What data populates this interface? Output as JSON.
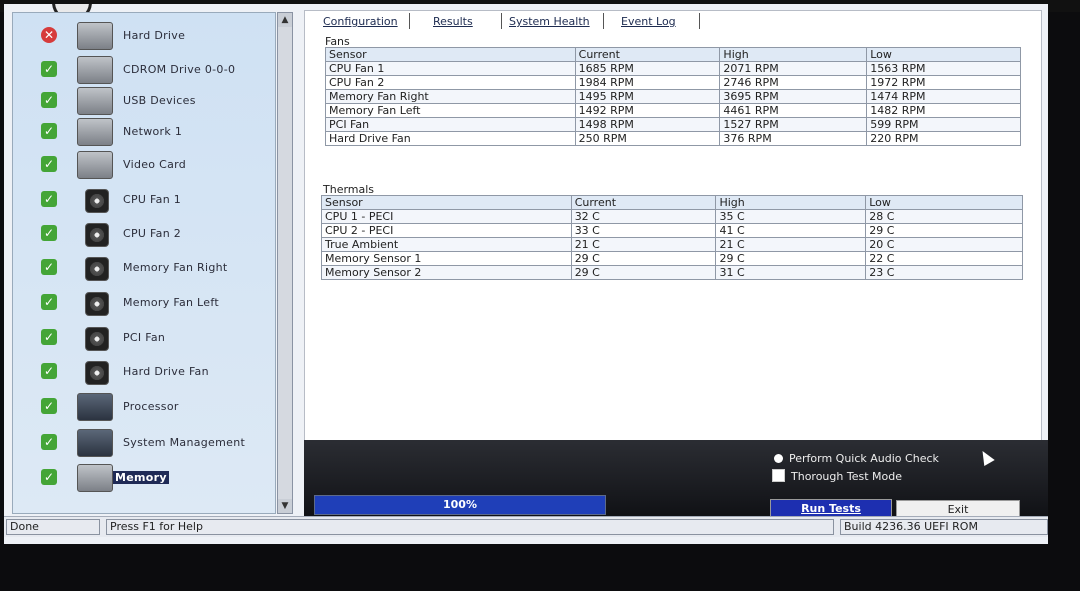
{
  "sidebar": {
    "items": [
      {
        "label": "Hard Drive",
        "status": "fail",
        "icon": "hard-drive-icon"
      },
      {
        "label": "CDROM Drive 0-0-0",
        "status": "pass",
        "icon": "cdrom-drive-icon"
      },
      {
        "label": "USB Devices",
        "status": "pass",
        "icon": "usb-icon"
      },
      {
        "label": "Network 1",
        "status": "pass",
        "icon": "network-card-icon"
      },
      {
        "label": "Video Card",
        "status": "pass",
        "icon": "video-card-icon"
      },
      {
        "label": "CPU Fan 1",
        "status": "pass",
        "icon": "fan-icon"
      },
      {
        "label": "CPU Fan 2",
        "status": "pass",
        "icon": "fan-icon"
      },
      {
        "label": "Memory Fan Right",
        "status": "pass",
        "icon": "fan-icon"
      },
      {
        "label": "Memory Fan Left",
        "status": "pass",
        "icon": "fan-icon"
      },
      {
        "label": "PCI Fan",
        "status": "pass",
        "icon": "fan-icon"
      },
      {
        "label": "Hard Drive Fan",
        "status": "pass",
        "icon": "fan-icon"
      },
      {
        "label": "Processor",
        "status": "pass",
        "icon": "processor-icon"
      },
      {
        "label": "System Management",
        "status": "pass",
        "icon": "system-management-icon"
      },
      {
        "label": "Memory",
        "status": "pass",
        "icon": "memory-icon",
        "selected": true
      }
    ]
  },
  "tabs": [
    "Configuration",
    "Results",
    "System Health",
    "Event Log"
  ],
  "fans": {
    "title": "Fans",
    "headers": [
      "Sensor",
      "Current",
      "High",
      "Low"
    ],
    "rows": [
      [
        "CPU Fan 1",
        "1685 RPM",
        "2071 RPM",
        "1563 RPM"
      ],
      [
        "CPU Fan 2",
        "1984 RPM",
        "2746 RPM",
        "1972 RPM"
      ],
      [
        "Memory Fan Right",
        "1495 RPM",
        "3695 RPM",
        "1474 RPM"
      ],
      [
        "Memory Fan Left",
        "1492 RPM",
        "4461 RPM",
        "1482 RPM"
      ],
      [
        "PCI Fan",
        "1498 RPM",
        "1527 RPM",
        "599 RPM"
      ],
      [
        "Hard Drive Fan",
        "250 RPM",
        "376 RPM",
        "220 RPM"
      ]
    ]
  },
  "thermals": {
    "title": "Thermals",
    "headers": [
      "Sensor",
      "Current",
      "High",
      "Low"
    ],
    "rows": [
      [
        "CPU 1 - PECI",
        "32 C",
        "35 C",
        "28 C"
      ],
      [
        "CPU 2 - PECI",
        "33 C",
        "41 C",
        "29 C"
      ],
      [
        "True Ambient",
        "21 C",
        "21 C",
        "20 C"
      ],
      [
        "Memory Sensor 1",
        "29 C",
        "29 C",
        "22 C"
      ],
      [
        "Memory Sensor 2",
        "29 C",
        "31 C",
        "23 C"
      ]
    ]
  },
  "options": {
    "quick_audio": "Perform Quick Audio Check",
    "thorough": "Thorough Test Mode"
  },
  "progress": {
    "text": "100%",
    "fraction": 1.0
  },
  "buttons": {
    "run": "Run Tests",
    "exit": "Exit"
  },
  "status": {
    "left": "Done",
    "help": "Press F1 for Help",
    "build": "Build  4236.36 UEFI ROM"
  },
  "colors": {
    "pass": "#44a537",
    "fail": "#d63b3b",
    "accent": "#1d2fb0"
  }
}
